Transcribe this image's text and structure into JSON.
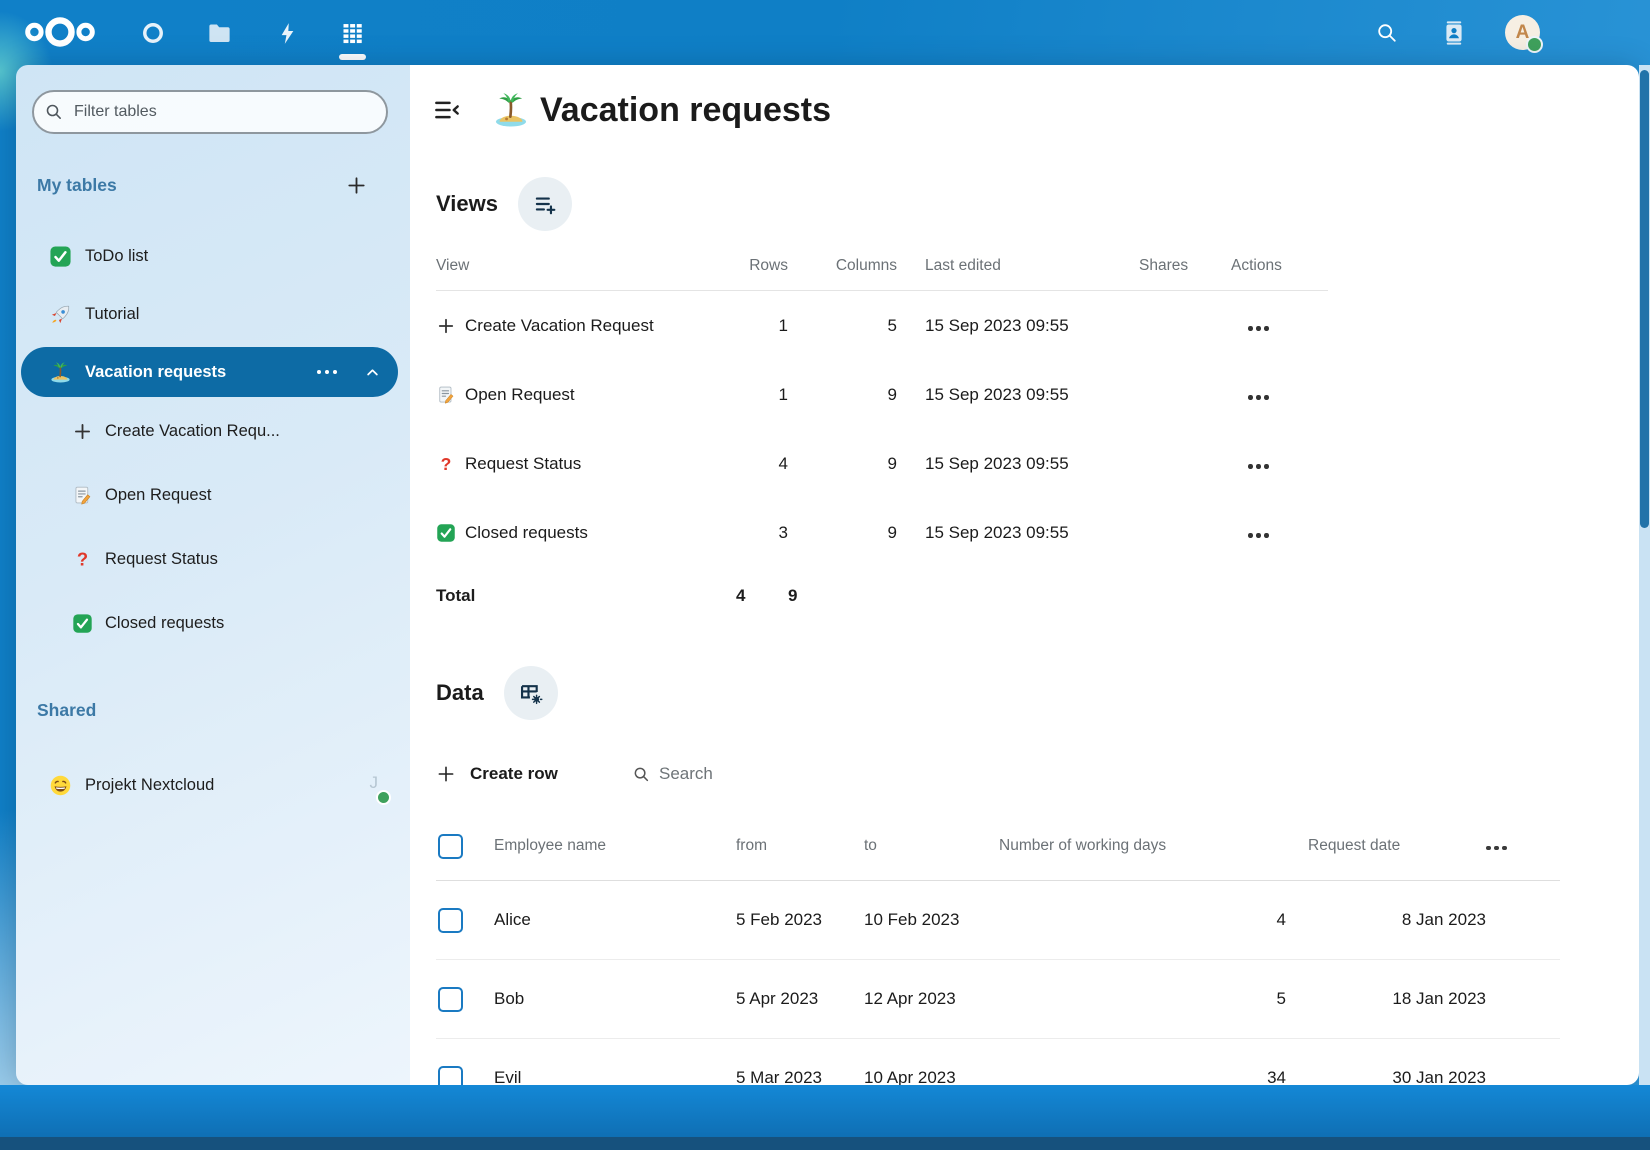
{
  "topbar": {
    "logo_icon": "nextcloud-logo",
    "apps": [
      {
        "name": "dashboard",
        "icon": "dashboard-icon",
        "active": false
      },
      {
        "name": "files",
        "icon": "folder-icon",
        "active": false
      },
      {
        "name": "activity",
        "icon": "lightning-icon",
        "active": false
      },
      {
        "name": "tables",
        "icon": "tables-icon",
        "active": true
      }
    ],
    "search_icon": "search-icon",
    "contacts_icon": "contacts-icon",
    "avatar": {
      "initial": "A",
      "status_color": "#3fa15c"
    }
  },
  "sidebar": {
    "filter": {
      "placeholder": "Filter tables"
    },
    "my_tables": {
      "title": "My tables",
      "items": [
        {
          "icon": "check-green",
          "label": "ToDo list",
          "selected": false
        },
        {
          "icon": "rocket",
          "label": "Tutorial",
          "selected": false
        },
        {
          "icon": "island",
          "label": "Vacation requests",
          "selected": true
        }
      ],
      "selected_children": [
        {
          "icon": "plus",
          "label": "Create Vacation Requ..."
        },
        {
          "icon": "memo",
          "label": "Open Request"
        },
        {
          "icon": "question",
          "label": "Request Status"
        },
        {
          "icon": "check-green",
          "label": "Closed requests"
        }
      ]
    },
    "shared": {
      "title": "Shared",
      "items": [
        {
          "icon": "grin",
          "label": "Projekt Nextcloud",
          "owner_initial": "J"
        }
      ]
    }
  },
  "main": {
    "title": "Vacation requests",
    "title_icon": "island",
    "views": {
      "heading": "Views",
      "columns": [
        "View",
        "Rows",
        "Columns",
        "Last edited",
        "Shares",
        "Actions"
      ],
      "rows": [
        {
          "icon": "plus",
          "name": "Create Vacation Request",
          "rows": "1",
          "columns": "5",
          "last_edited": "15 Sep 2023 09:55"
        },
        {
          "icon": "memo",
          "name": "Open Request",
          "rows": "1",
          "columns": "9",
          "last_edited": "15 Sep 2023 09:55"
        },
        {
          "icon": "question",
          "name": "Request Status",
          "rows": "4",
          "columns": "9",
          "last_edited": "15 Sep 2023 09:55"
        },
        {
          "icon": "check-green",
          "name": "Closed requests",
          "rows": "3",
          "columns": "9",
          "last_edited": "15 Sep 2023 09:55"
        }
      ],
      "total": {
        "label": "Total",
        "rows": "4",
        "columns": "9"
      }
    },
    "data": {
      "heading": "Data",
      "create_row_label": "Create row",
      "search_placeholder": "Search",
      "columns": [
        "Employee name",
        "from",
        "to",
        "Number of working days",
        "Request date"
      ],
      "rows": [
        {
          "employee": "Alice",
          "from": "5 Feb 2023",
          "to": "10 Feb 2023",
          "working_days": "4",
          "request_date": "8 Jan 2023"
        },
        {
          "employee": "Bob",
          "from": "5 Apr 2023",
          "to": "12 Apr 2023",
          "working_days": "5",
          "request_date": "18 Jan 2023"
        },
        {
          "employee": "Evil",
          "from": "5 Mar 2023",
          "to": "10 Apr 2023",
          "working_days": "34",
          "request_date": "30 Jan 2023"
        }
      ]
    }
  },
  "colors": {
    "primary_blue": "#0f7fc6",
    "selected_pill": "#0d6ba5",
    "checkbox_border": "#1a7ac2",
    "status_green": "#3fa15c"
  }
}
